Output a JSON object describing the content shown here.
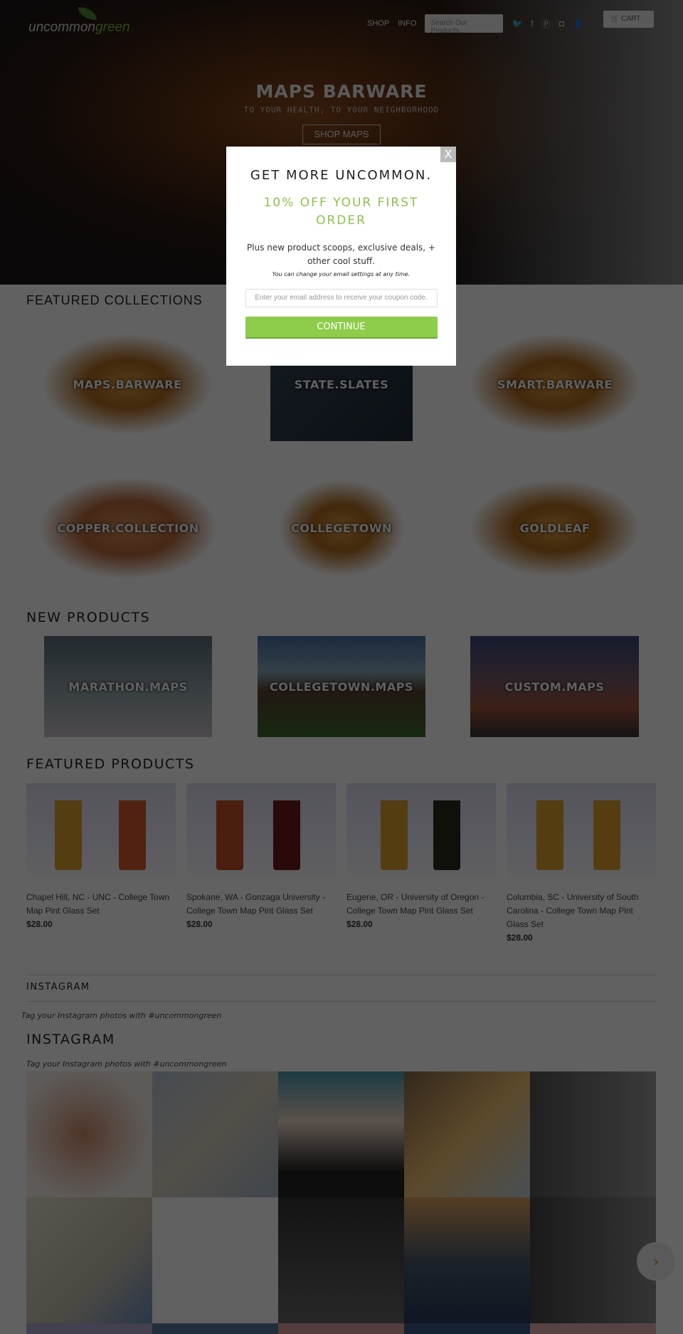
{
  "header": {
    "logo_a": "uncommon",
    "logo_b": "green",
    "nav": [
      "SHOP",
      "INFO"
    ],
    "search_placeholder": "Search Our Products...",
    "cart": "CART"
  },
  "hero": {
    "title": "MAPS BARWARE",
    "subtitle": "TO YOUR HEALTH, TO YOUR NEIGHBORHOOD",
    "button": "SHOP MAPS"
  },
  "featured_collections": {
    "title": "FEATURED COLLECTIONS",
    "items": [
      "MAPS.BARWARE",
      "STATE.SLATES",
      "SMART.BARWARE",
      "COPPER.COLLECTION",
      "COLLEGETOWN",
      "GOLDLEAF"
    ]
  },
  "new_products": {
    "title": "NEW PRODUCTS",
    "items": [
      "MARATHON.MAPS",
      "COLLEGETOWN.MAPS",
      "CUSTOM.MAPS"
    ]
  },
  "featured_products": {
    "title": "FEATURED PRODUCTS",
    "items": [
      {
        "name": "Chapel Hill, NC - UNC - College Town Map Pint Glass Set",
        "price": "$28.00"
      },
      {
        "name": "Spokane, WA - Gonzaga University - College Town Map Pint Glass Set",
        "price": "$28.00"
      },
      {
        "name": "Eugene, OR - University of Oregon - College Town Map Pint Glass Set",
        "price": "$28.00"
      },
      {
        "name": "Columbia, SC - University of South Carolina - College Town Map Pint Glass Set",
        "price": "$28.00"
      }
    ]
  },
  "instagram": {
    "title_small": "INSTAGRAM",
    "tag_small": "Tag your Instagram photos with #uncommongreen",
    "title": "INSTAGRAM",
    "tag": "Tag your Instagram photos with #uncommongreen"
  },
  "modal": {
    "close": "X",
    "title": "GET MORE UNCOMMON.",
    "offer": "10% OFF YOUR FIRST ORDER",
    "body": "Plus new product scoops, exclusive deals, + other cool stuff.",
    "note": "You can change your email settings at any time.",
    "email_placeholder": "Enter your email address to receive your coupon code.",
    "button": "CONTINUE"
  },
  "colors": {
    "accent": "#8dcd4b",
    "overlay": "rgba(0,0,0,0.65)"
  }
}
